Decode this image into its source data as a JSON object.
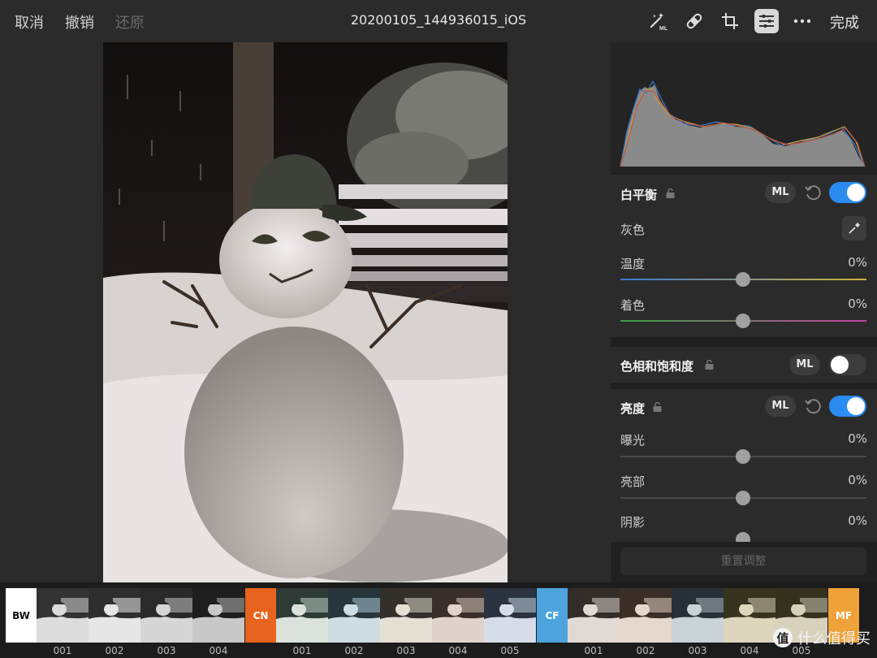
{
  "toolbar": {
    "cancel": "取消",
    "undo": "撤销",
    "redo": "还原",
    "title": "20200105_144936015_iOS",
    "done": "完成"
  },
  "tools": [
    "ml-auto-enhance-icon",
    "healing-bandage-icon",
    "crop-icon",
    "adjust-sliders-icon",
    "more-icon"
  ],
  "panel": {
    "white_balance": {
      "title": "白平衡",
      "ml": "ML",
      "enabled": true,
      "gray_label": "灰色",
      "temperature": {
        "label": "温度",
        "value": "0%"
      },
      "tint": {
        "label": "着色",
        "value": "0%"
      }
    },
    "hue_saturation": {
      "title": "色相和饱和度",
      "ml": "ML",
      "enabled": false
    },
    "brightness": {
      "title": "亮度",
      "ml": "ML",
      "enabled": true,
      "exposure": {
        "label": "曝光",
        "value": "0%"
      },
      "highlights": {
        "label": "亮部",
        "value": "0%"
      },
      "shadows": {
        "label": "阴影",
        "value": "0%"
      }
    },
    "reset_label": "重置调整"
  },
  "filmstrip": {
    "groups": [
      {
        "tag": "BW",
        "tag_color": "#ffffff",
        "tag_text_color": "#111111",
        "items": [
          "001",
          "002",
          "003",
          "004"
        ]
      },
      {
        "tag": "CN",
        "tag_color": "#e8641e",
        "tag_text_color": "#ffffff",
        "items": [
          "001",
          "002",
          "003",
          "004",
          "005"
        ]
      },
      {
        "tag": "CF",
        "tag_color": "#4da3dc",
        "tag_text_color": "#ffffff",
        "items": [
          "001",
          "002",
          "003",
          "004",
          "005"
        ]
      },
      {
        "tag": "MF",
        "tag_color": "#f0a23a",
        "tag_text_color": "#ffffff",
        "items": []
      }
    ]
  },
  "watermark": {
    "badge": "值",
    "text": "什么值得买"
  },
  "accent_color": "#2a8cf0"
}
